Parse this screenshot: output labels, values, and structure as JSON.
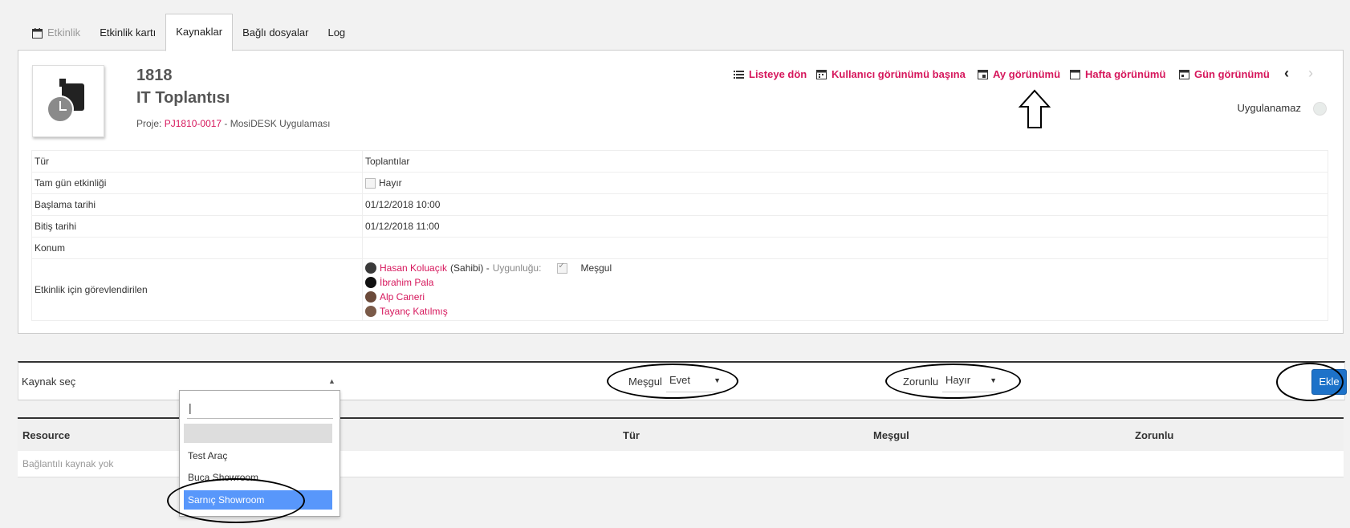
{
  "tabs": [
    {
      "label": "Etkinlik"
    },
    {
      "label": "Etkinlik kartı"
    },
    {
      "label": "Kaynaklar"
    },
    {
      "label": "Bağlı dosyalar"
    },
    {
      "label": "Log"
    }
  ],
  "record": {
    "number": "1818",
    "title": "IT Toplantısı",
    "project_label": "Proje:",
    "project_ref": "PJ1810-0017",
    "project_sep": " - ",
    "project_name": "MosiDESK Uygulaması",
    "status": "Uygulanamaz"
  },
  "toolbar": {
    "list": "Listeye dön",
    "user_view": "Kullanıcı görünümü başına",
    "month_view": "Ay görünümü",
    "week_view": "Hafta görünümü",
    "day_view": "Gün görünümü",
    "prev": "‹",
    "next": "›"
  },
  "details": {
    "type_label": "Tür",
    "type_value": "Toplantılar",
    "allday_label": "Tam gün etkinliği",
    "allday_value": "Hayır",
    "start_label": "Başlama tarihi",
    "start_value": "01/12/2018 10:00",
    "end_label": "Bitiş tarihi",
    "end_value": "01/12/2018 11:00",
    "location_label": "Konum",
    "location_value": "",
    "assignees_label": "Etkinlik için görevlendirilen",
    "assignees": [
      {
        "name": "Hasan Koluaçık",
        "suffix": "(Sahibi) -",
        "avail_label": "Uygunluğu:",
        "busy": "Meşgul"
      },
      {
        "name": "İbrahim Pala"
      },
      {
        "name": "Alp Caneri"
      },
      {
        "name": "Tayanç Katılmış"
      }
    ]
  },
  "resource_form": {
    "select_label": "Kaynak seç",
    "busy_label": "Meşgul",
    "busy_value": "Evet",
    "mandatory_label": "Zorunlu",
    "mandatory_value": "Hayır",
    "add_button": "Ekle"
  },
  "dropdown": {
    "search_value": "|",
    "options": [
      "",
      "Test Araç",
      "Buca Showroom",
      "Sarnıç Showroom"
    ],
    "selected": "Sarnıç Showroom"
  },
  "results": {
    "columns": [
      "Resource",
      "Tür",
      "Meşgul",
      "Zorunlu"
    ],
    "empty_text": "Bağlantılı kaynak yok"
  },
  "colors": {
    "accent": "#d6175c",
    "button": "#1d72c9",
    "selected_option": "#5897fb"
  }
}
